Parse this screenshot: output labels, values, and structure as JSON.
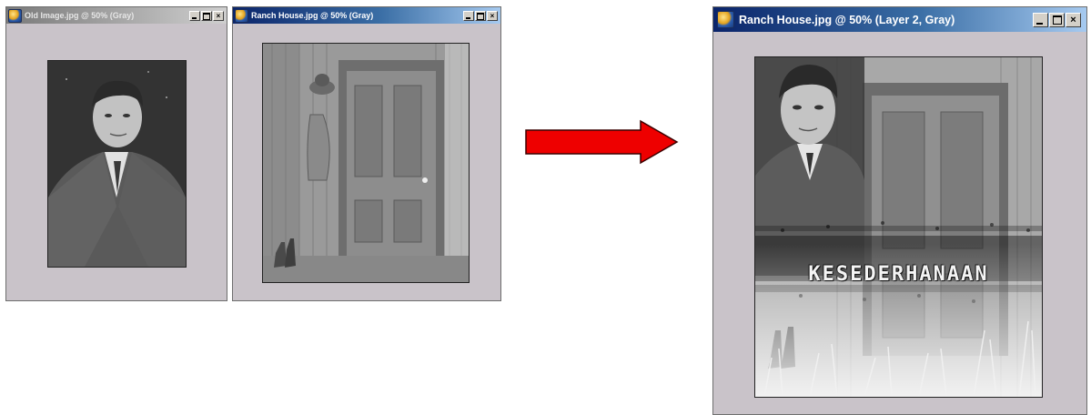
{
  "windows": {
    "old_image": {
      "title": "Old Image.jpg @ 50% (Gray)",
      "state": "inactive"
    },
    "ranch_small": {
      "title": "Ranch House.jpg @ 50% (Gray)",
      "state": "active"
    },
    "ranch_result": {
      "title": "Ranch House.jpg @ 50% (Layer 2, Gray)",
      "state": "active"
    }
  },
  "result_overlay_text": "KESEDERHANAAN",
  "icons": {
    "app": "photoshop-document-icon",
    "minimize": "minimize-icon",
    "maximize": "maximize-icon",
    "close": "close-icon",
    "arrow": "right-arrow-icon"
  },
  "colors": {
    "window_bg": "#c9c3c9",
    "title_active": "#0a246a",
    "title_inactive": "#7a7a7a",
    "arrow_fill": "#ee0000"
  }
}
